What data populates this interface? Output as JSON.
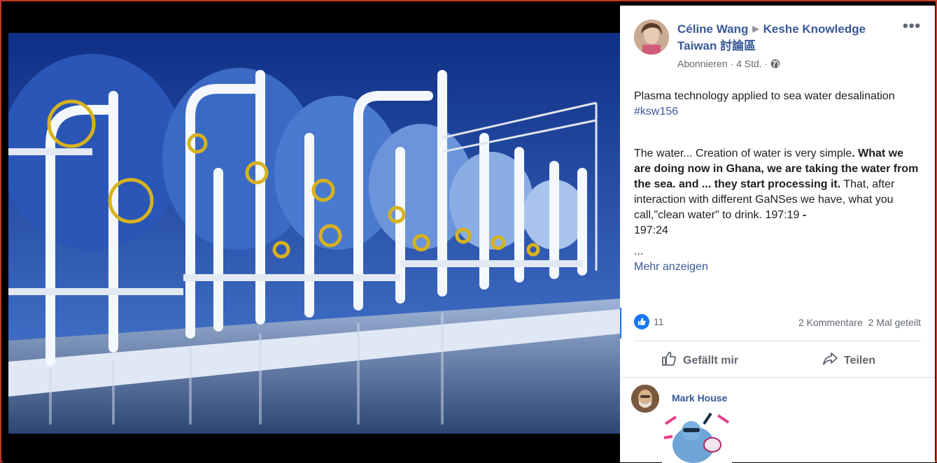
{
  "post": {
    "author": "Céline Wang",
    "group": "Keshe Knowledge Taiwan 討論區",
    "follow_label": "Abonnieren",
    "time": "4 Std.",
    "separator": "·",
    "text_line1": "Plasma technology applied to sea water desalination",
    "hashtag": "#ksw156",
    "body_part1": "The water... Creation of water is very simple",
    "body_bold": ". What we are doing now in Ghana,  we are taking the water from the sea. and ... they start processing it.",
    "body_part2": " That, after interaction with different GaNSes we have, what you call,\"clean water\" to drink.  197:19",
    "body_dash": " -",
    "body_part3": "197:24",
    "ellipsis": "...",
    "see_more": "Mehr anzeigen",
    "more_options": "•••"
  },
  "reactions": {
    "like_count": "11",
    "comments": "2 Kommentare",
    "shares": "2 Mal geteilt"
  },
  "actions": {
    "like_label": "Gefällt mir",
    "share_label": "Teilen"
  },
  "comment": {
    "author": "Mark House"
  },
  "icons": {
    "like": "thumbs-up-icon",
    "share": "share-arrow-icon",
    "privacy": "globe-icon",
    "more": "more-options-icon"
  },
  "colors": {
    "link": "#385898",
    "like_blue": "#1877f2",
    "frame_border": "#c0392b"
  }
}
